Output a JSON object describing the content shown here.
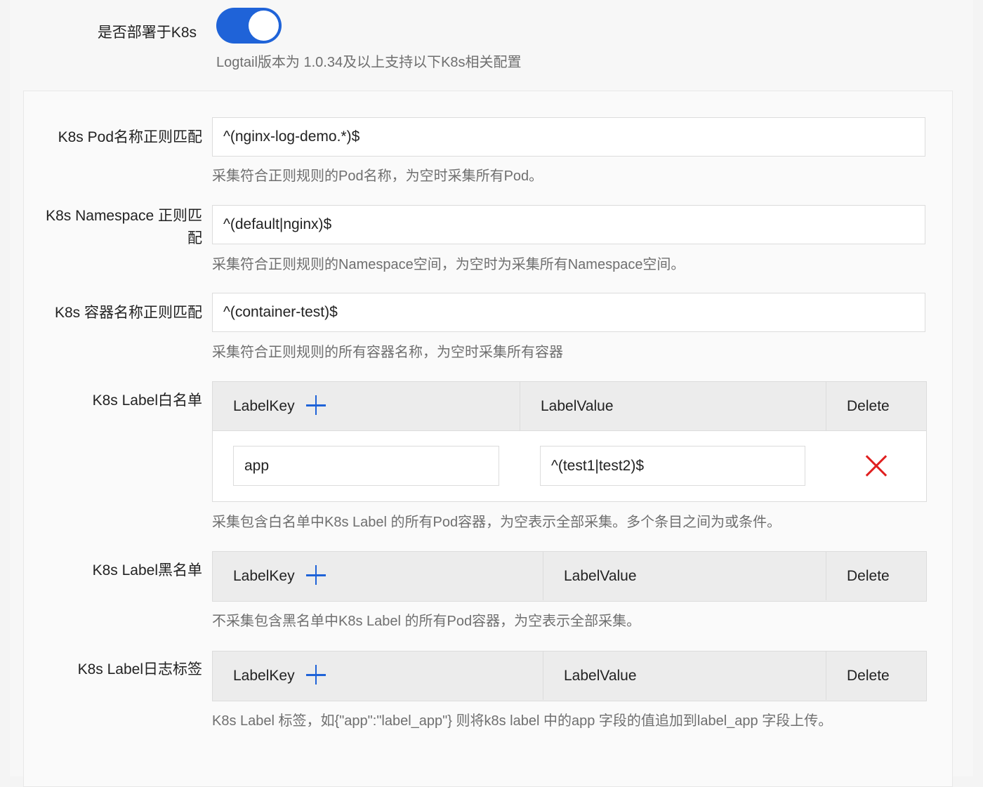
{
  "deploy": {
    "label": "是否部署于K8s",
    "enabled": true,
    "hint": "Logtail版本为 1.0.34及以上支持以下K8s相关配置"
  },
  "pod_regex": {
    "label": "K8s Pod名称正则匹配",
    "value": "^(nginx-log-demo.*)$",
    "hint": "采集符合正则规则的Pod名称，为空时采集所有Pod。"
  },
  "namespace_regex": {
    "label_line1": "K8s Namespace 正则匹",
    "label_line2": "配",
    "value": "^(default|nginx)$",
    "hint": "采集符合正则规则的Namespace空间，为空时为采集所有Namespace空间。"
  },
  "container_regex": {
    "label": "K8s 容器名称正则匹配",
    "value": "^(container-test)$",
    "hint": "采集符合正则规则的所有容器名称，为空时采集所有容器"
  },
  "whitelist": {
    "label": "K8s Label白名单",
    "columns": {
      "key": "LabelKey",
      "value": "LabelValue",
      "delete": "Delete"
    },
    "rows": [
      {
        "key": "app",
        "value": "^(test1|test2)$"
      }
    ],
    "hint": "采集包含白名单中K8s Label 的所有Pod容器，为空表示全部采集。多个条目之间为或条件。"
  },
  "blacklist": {
    "label": "K8s Label黑名单",
    "columns": {
      "key": "LabelKey",
      "value": "LabelValue",
      "delete": "Delete"
    },
    "rows": [],
    "hint": "不采集包含黑名单中K8s Label 的所有Pod容器，为空表示全部采集。"
  },
  "log_tags": {
    "label": "K8s Label日志标签",
    "columns": {
      "key": "LabelKey",
      "value": "LabelValue",
      "delete": "Delete"
    },
    "rows": [],
    "hint": "K8s Label 标签，如{\"app\":\"label_app\"} 则将k8s label 中的app 字段的值追加到label_app 字段上传。"
  },
  "colors": {
    "accent": "#1f63d8",
    "danger": "#e02020",
    "hint_text": "#6f6f6f"
  },
  "icons": {
    "add": "plus-icon",
    "remove": "close-x-icon"
  }
}
